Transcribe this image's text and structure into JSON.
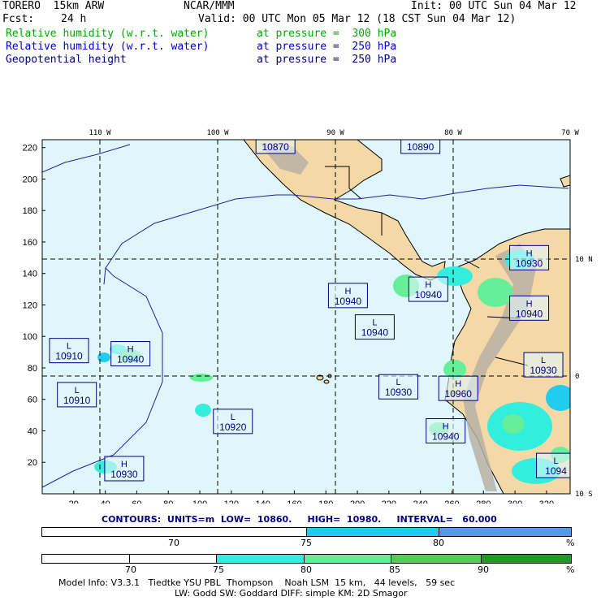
{
  "header": {
    "model": "TORERO  15km ARW",
    "center": "NCAR/MMM",
    "init": "Init: 00 UTC Sun 04 Mar 12",
    "fcst_label": "Fcst:",
    "fcst_value": "24 h",
    "valid": "Valid: 00 UTC Mon 05 Mar 12 (18 CST Sun 04 Mar 12)",
    "fields": [
      {
        "name": "Relative humidity (w.r.t. water)",
        "level": "at pressure =  300 hPa"
      },
      {
        "name": "Relative humidity (w.r.t. water)",
        "level": "at pressure =  250 hPa"
      },
      {
        "name": "Geopotential height",
        "level": "at pressure =  250 hPa"
      }
    ]
  },
  "map": {
    "lon_labels": [
      "110 W",
      "100 W",
      "90 W",
      "80 W",
      "70 W"
    ],
    "lat_labels": [
      "10 N",
      "0",
      "10 S"
    ],
    "x_ticks": [
      "20",
      "40",
      "60",
      "80",
      "100",
      "120",
      "140",
      "160",
      "180",
      "200",
      "220",
      "240",
      "260",
      "280",
      "300",
      "320"
    ],
    "y_ticks": [
      "20",
      "40",
      "60",
      "80",
      "100",
      "120",
      "140",
      "160",
      "180",
      "200",
      "220"
    ],
    "pressure_systems": [
      {
        "type": "L",
        "value": "10870",
        "x": 148,
        "y": 224
      },
      {
        "type": "H",
        "value": "10890",
        "x": 240,
        "y": 224
      },
      {
        "type": "H",
        "value": "10930",
        "x": 309,
        "y": 150
      },
      {
        "type": "H",
        "value": "10940",
        "x": 194,
        "y": 126
      },
      {
        "type": "H",
        "value": "10940",
        "x": 245,
        "y": 130
      },
      {
        "type": "H",
        "value": "10940",
        "x": 309,
        "y": 118
      },
      {
        "type": "L",
        "value": "10940",
        "x": 211,
        "y": 106
      },
      {
        "type": "L",
        "value": "10910",
        "x": 17,
        "y": 91
      },
      {
        "type": "H",
        "value": "10940",
        "x": 56,
        "y": 89
      },
      {
        "type": "L",
        "value": "10930",
        "x": 318,
        "y": 82
      },
      {
        "type": "L",
        "value": "10930",
        "x": 226,
        "y": 68
      },
      {
        "type": "H",
        "value": "10960",
        "x": 264,
        "y": 67
      },
      {
        "type": "L",
        "value": "10910",
        "x": 22,
        "y": 63
      },
      {
        "type": "L",
        "value": "10920",
        "x": 121,
        "y": 46
      },
      {
        "type": "H",
        "value": "10940",
        "x": 256,
        "y": 40
      },
      {
        "type": "H",
        "value": "10930",
        "x": 52,
        "y": 16
      },
      {
        "type": "L",
        "value": "1094",
        "x": 326,
        "y": 18
      }
    ]
  },
  "contours": {
    "label": "CONTOURS:",
    "units": "UNITS=m",
    "low": "LOW=  10860.",
    "high": "HIGH=  10980.",
    "interval": "INTERVAL=   60.000"
  },
  "colorbars": [
    {
      "labels": [
        "70",
        "75",
        "80",
        "%"
      ],
      "segments": [
        {
          "pct": 50,
          "color": "#ffffff"
        },
        {
          "pct": 25,
          "color": "#22ccee"
        },
        {
          "pct": 25,
          "color": "#5599ee"
        }
      ]
    },
    {
      "labels": [
        "70",
        "75",
        "80",
        "85",
        "90",
        "%"
      ],
      "segments": [
        {
          "pct": 16.5,
          "color": "#ffffff"
        },
        {
          "pct": 16.5,
          "color": "#ffffff"
        },
        {
          "pct": 16.5,
          "color": "#33eedd"
        },
        {
          "pct": 16.5,
          "color": "#66ee99"
        },
        {
          "pct": 17,
          "color": "#55cc55"
        },
        {
          "pct": 17,
          "color": "#229922"
        }
      ]
    }
  ],
  "footer": {
    "line1": "Model Info: V3.3.1   Tiedtke YSU PBL  Thompson    Noah LSM  15 km,   44 levels,   59 sec",
    "line2": "LW: Godd SW: Goddard DIFF: simple KM: 2D Smagor"
  },
  "colors": {
    "ocean": "#dff7fb",
    "land": "#f4d9a6",
    "mountain": "#b8b0a4",
    "labels": "#000080",
    "rh_blue": "#22ccee",
    "rh_green": "#66ee99"
  }
}
